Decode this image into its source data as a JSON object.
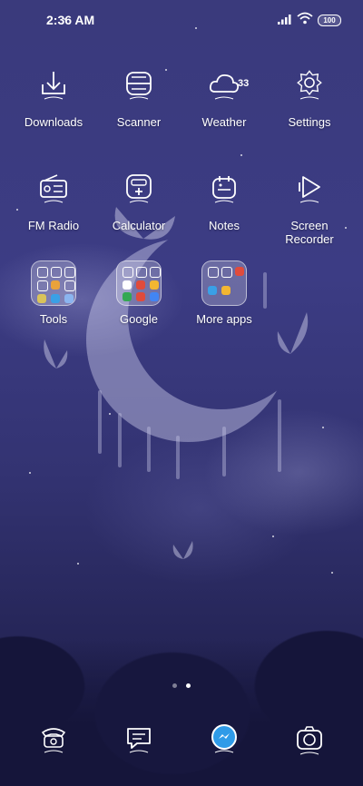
{
  "status_bar": {
    "time": "2:36 AM",
    "battery": "100"
  },
  "apps": {
    "downloads": "Downloads",
    "scanner": "Scanner",
    "weather": "Weather",
    "weather_temp": "33",
    "settings": "Settings",
    "fm_radio": "FM Radio",
    "calculator": "Calculator",
    "notes": "Notes",
    "screen_recorder": "Screen Recorder"
  },
  "folders": {
    "tools": "Tools",
    "google": "Google",
    "more_apps": "More apps"
  },
  "page_indicator": {
    "pages": 2,
    "current": 2
  },
  "colors": {
    "background": "#3a3a7c",
    "icon_stroke": "#ffffff",
    "messenger_accent": "#2f9be8"
  }
}
